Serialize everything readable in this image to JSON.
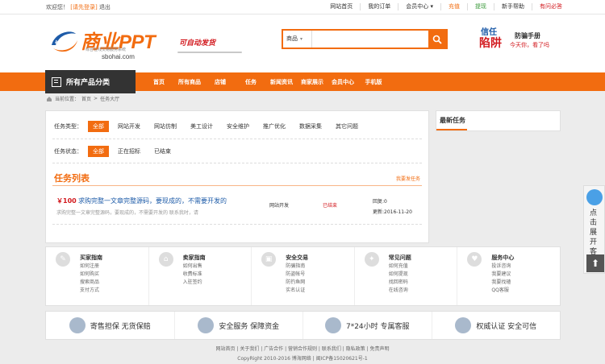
{
  "topbar": {
    "welcome": "欢迎您！",
    "login": "[请先登录]",
    "logout": "退出",
    "links": [
      {
        "label": "网站首页",
        "color": "#333333"
      },
      {
        "label": "我的订单",
        "color": "#333333"
      },
      {
        "label": "会员中心 ▾",
        "color": "#333333"
      },
      {
        "label": "充值",
        "color": "#f26c10"
      },
      {
        "label": "提现",
        "color": "#3a9a3a"
      },
      {
        "label": "新手帮助",
        "color": "#333333"
      },
      {
        "label": "有问必答",
        "color": "#d2191e"
      }
    ]
  },
  "logo": {
    "brand": "商业PPT",
    "slogan": "综合在线交易服务系统",
    "domain": "sbohai.com",
    "tagline": "可自动发货"
  },
  "search": {
    "category": "商品",
    "placeholder": ""
  },
  "ad": {
    "line1": "信任",
    "line2": "陷阱",
    "line3": "防骗手册",
    "line4": "今天你，看了吗"
  },
  "nav": {
    "category_label": "所有产品分类",
    "items": [
      "首页",
      "所有商品",
      "店铺",
      "任务",
      "新闻资讯",
      "商家展示",
      "会员中心",
      "手机版"
    ]
  },
  "breadcrumb": {
    "prefix": "当前位置：",
    "home": "首页",
    "sep": ">",
    "current": "任务大厅"
  },
  "filters": {
    "type_label": "任务类型：",
    "types": [
      "全部",
      "网站开发",
      "网站仿制",
      "美工设计",
      "安全维护",
      "推广优化",
      "数据采集",
      "其它问题"
    ],
    "status_label": "任务状态：",
    "statuses": [
      "全部",
      "正在招标",
      "已结束"
    ]
  },
  "tasks": {
    "title": "任务列表",
    "publish": "我要发任务",
    "items": [
      {
        "price": "￥100",
        "title": "求购完整一文章完整源码，要现成的，不需要开发的",
        "desc": "求购完整一文章完整源码，要现成的，不需要开发的 联系我时，请",
        "category": "网站开发",
        "status": "已结束",
        "bids": "回复:0",
        "updated": "更新:2016-11-20"
      }
    ]
  },
  "sidebar": {
    "title": "最新任务"
  },
  "help": [
    {
      "title": "买家指南",
      "items": [
        "如何注册",
        "如何购买",
        "搜索商品",
        "支付方式"
      ]
    },
    {
      "title": "卖家指南",
      "items": [
        "如何出售",
        "收费标准",
        "入驻签约"
      ]
    },
    {
      "title": "安全交易",
      "items": [
        "防骗指南",
        "防盗帐号",
        "防钓鱼网",
        "实名认证"
      ]
    },
    {
      "title": "常见问题",
      "items": [
        "如何充值",
        "如何提现",
        "找回密码",
        "在线咨询"
      ]
    },
    {
      "title": "服务中心",
      "items": [
        "投诉咨询",
        "我要建议",
        "我要找碴",
        "QQ客服"
      ]
    }
  ],
  "guarantees": [
    "寄售担保  无货保赔",
    "安全服务  保障资金",
    "7*24小时  专属客服",
    "权威认证  安全可信"
  ],
  "footer": {
    "links": "网站首页 | 关于我们 | 广告合作 | 营销合作规则 | 联系我们 | 隐私政策 | 免责声明",
    "copyright": "CopyRight 2010-2016 博海网络 | 闽ICP备15020621号-1"
  },
  "float": {
    "label": "点击展开客服"
  }
}
